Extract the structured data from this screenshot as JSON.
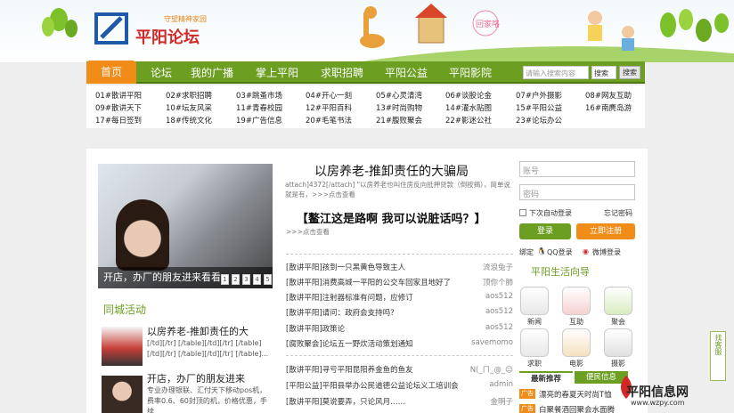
{
  "header": {
    "slogan": "守望精神家园",
    "site_name": "平阳论坛"
  },
  "nav": {
    "home": "首页",
    "items": [
      "论坛",
      "我的广播",
      "掌上平阳",
      "求职招聘",
      "平阳公益",
      "平阳影院"
    ],
    "search_placeholder": "请输入搜索内容",
    "search_select": "搜索",
    "search_button": "搜索"
  },
  "sublinks": [
    [
      "01#散讲平阳",
      "02#求职招聘",
      "03#跳蚤市场",
      "04#开心一刻",
      "05#心灵清湾",
      "06#谈股论金",
      "07#户外摄影",
      "08#网友互助"
    ],
    [
      "09#散讲天下",
      "10#坛友风采",
      "11#青春校园",
      "12#平阳百科",
      "13#时尚购物",
      "14#灌水贴图",
      "15#平阳公益",
      "16#南麂岛游"
    ],
    [
      "17#每日签到",
      "18#传统文化",
      "19#广告信息",
      "20#毛笔书法",
      "21#腹败聚会",
      "22#影迷公社",
      "23#论坛办公"
    ]
  ],
  "slide": {
    "caption": "开店，办厂的朋友进来看看",
    "dots": [
      "1",
      "2",
      "3",
      "4",
      "5"
    ]
  },
  "activity": {
    "title": "同城活动",
    "items": [
      {
        "title": "以房养老-推卸责任的大",
        "text": "[/td][/tr] [/table][/td][/tr] [/table][/td][/tr] [/table][/td][/tr] [/table]..."
      },
      {
        "title": "开店，办厂的朋友进来",
        "text": "专业办理银联、汇付天下移动pos机，费率0.6、60封顶的机，价格优惠，手续"
      }
    ]
  },
  "headline": {
    "title": "以房养老-推卸责任的大骗局",
    "summary": "attach]4372[/attach] \"以房养老也叫住房反向抵押贷款（倒按揭），简单说就是有，>>>点击查看",
    "title2": "【鳌江这是路啊 我可以说脏话吗？】",
    "more2": ">>>点击查看"
  },
  "news": [
    {
      "t": "[散讲平阳]孩到一只黑黄色导致主人",
      "u": "流浪兔子"
    },
    {
      "t": "[散讲平阳]消费高城一平阳的公交车回家且地好了",
      "u": "顶你个肺"
    },
    {
      "t": "[散讲平阳]注射器标准有问题，应修订",
      "u": "aos512"
    },
    {
      "t": "[散讲平阳]请问：政府会支持吗？",
      "u": "aos512"
    },
    {
      "t": "[散讲平阳]政策论",
      "u": "aos512"
    },
    {
      "t": "[腐败聚会]论坛五一野炊活动策划通知",
      "u": "savemomo"
    },
    {
      "t": "[散讲平阳]寻亏平阳昆阳养金鱼的鱼友",
      "u": "N(_ㄇ_@_☺"
    },
    {
      "t": "[平阳公益]平阳县举办公民道德公益论坛义工培训会",
      "u": "admin"
    },
    {
      "t": "[散讲平阳]莫说要弄，只论风月……",
      "u": "金明子"
    }
  ],
  "login": {
    "user_placeholder": "账号",
    "pass_placeholder": "密码",
    "remember": "下次自动登录",
    "forgot": "忘记密码",
    "login_btn": "登录",
    "register_btn": "立即注册",
    "bind": "绑定",
    "qq": "QQ登录",
    "weibo": "微博登录"
  },
  "guide": {
    "title": "平阳生活向导",
    "items": [
      "新闻",
      "互助",
      "聚会",
      "求职",
      "电影",
      "摄影"
    ]
  },
  "tabs": {
    "a": "最新推荐",
    "b": "便民信息"
  },
  "ads": [
    {
      "tag": "广告",
      "text": "漂亮的春夏天时尚T恤"
    },
    {
      "tag": "广告",
      "text": "白聚餐酒回聚会水面腾"
    }
  ],
  "side": {
    "text": "找客服"
  },
  "brand": {
    "name": "平阳信息网",
    "url": "www.wzpy.com"
  },
  "colors": {
    "green": "#6c9e22",
    "orange": "#f28c19",
    "red": "#d32828"
  }
}
